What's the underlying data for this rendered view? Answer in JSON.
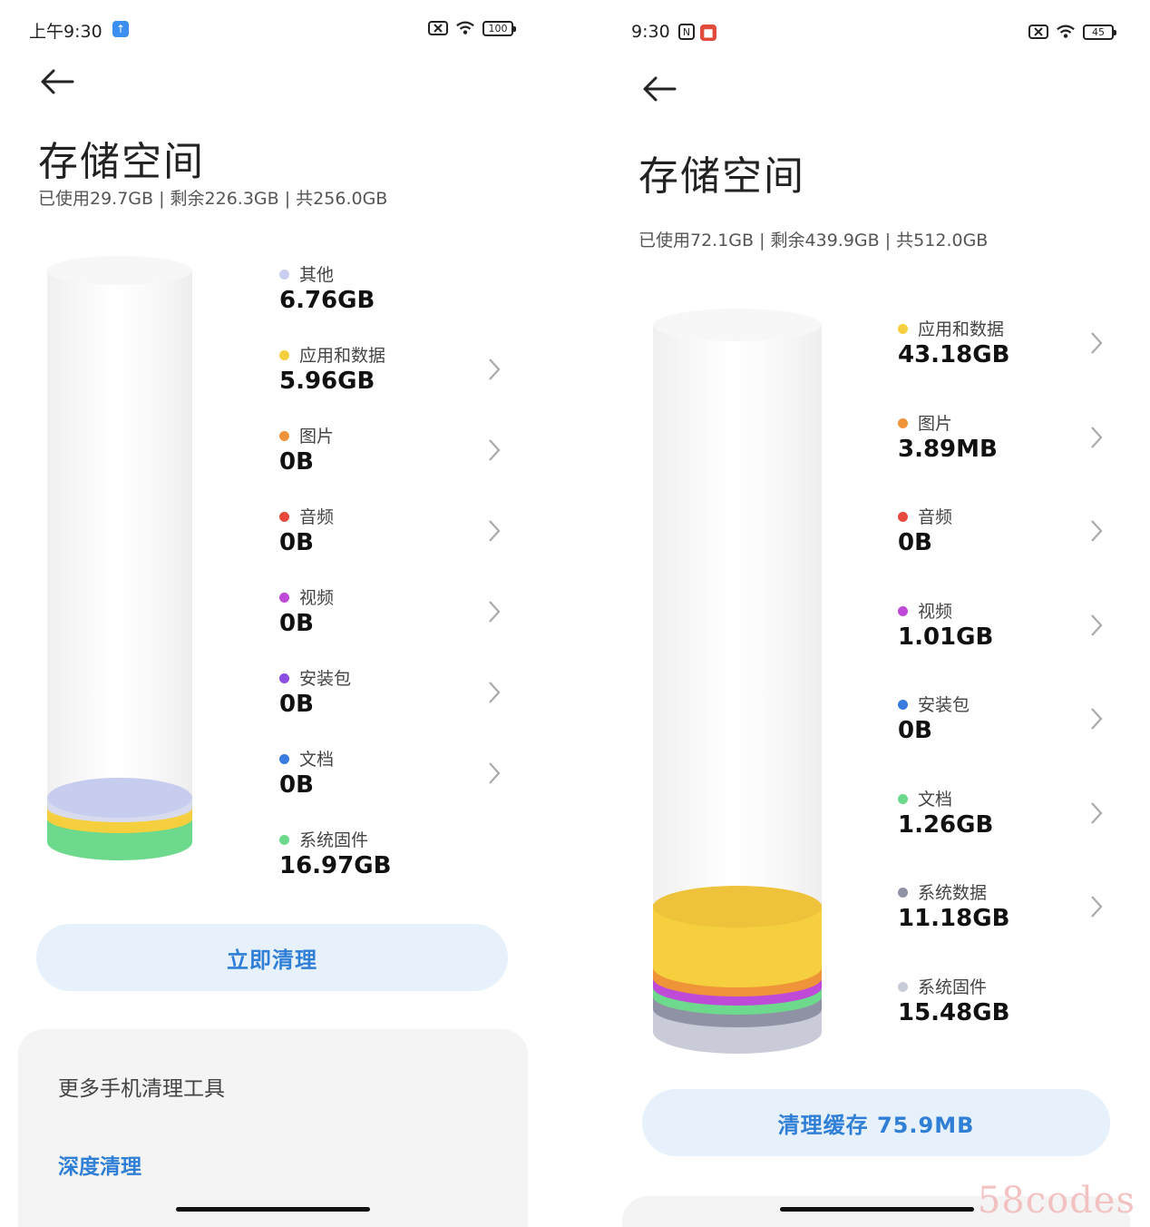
{
  "left": {
    "status": {
      "time": "上午9:30",
      "battery": "100"
    },
    "title": "存储空间",
    "summary": "已使用29.7GB | 剩余226.3GB | 共256.0GB",
    "items": [
      {
        "label": "其他",
        "value": "6.76GB",
        "color": "#c9cdf0",
        "chevron": false
      },
      {
        "label": "应用和数据",
        "value": "5.96GB",
        "color": "#f5cf3d",
        "chevron": true
      },
      {
        "label": "图片",
        "value": "0B",
        "color": "#f0943a",
        "chevron": true
      },
      {
        "label": "音频",
        "value": "0B",
        "color": "#e8493d",
        "chevron": true
      },
      {
        "label": "视频",
        "value": "0B",
        "color": "#c04ad8",
        "chevron": true
      },
      {
        "label": "安装包",
        "value": "0B",
        "color": "#8a4fe0",
        "chevron": true
      },
      {
        "label": "文档",
        "value": "0B",
        "color": "#3a7be0",
        "chevron": true
      },
      {
        "label": "系统固件",
        "value": "16.97GB",
        "color": "#6dd98c",
        "chevron": false
      }
    ],
    "action_button": "立即清理",
    "card": {
      "title": "更多手机清理工具",
      "link": "深度清理"
    }
  },
  "right": {
    "status": {
      "time": "9:30",
      "battery": "45"
    },
    "title": "存储空间",
    "summary": "已使用72.1GB | 剩余439.9GB | 共512.0GB",
    "items": [
      {
        "label": "应用和数据",
        "value": "43.18GB",
        "color": "#f5cf3d",
        "chevron": true
      },
      {
        "label": "图片",
        "value": "3.89MB",
        "color": "#f0943a",
        "chevron": true
      },
      {
        "label": "音频",
        "value": "0B",
        "color": "#e8493d",
        "chevron": true
      },
      {
        "label": "视频",
        "value": "1.01GB",
        "color": "#c04ad8",
        "chevron": true
      },
      {
        "label": "安装包",
        "value": "0B",
        "color": "#3a7be0",
        "chevron": true
      },
      {
        "label": "文档",
        "value": "1.26GB",
        "color": "#6dd98c",
        "chevron": true
      },
      {
        "label": "系统数据",
        "value": "11.18GB",
        "color": "#8f92a4",
        "chevron": true
      },
      {
        "label": "系统固件",
        "value": "15.48GB",
        "color": "#c9cbd8",
        "chevron": false
      }
    ],
    "action_button": "清理缓存 75.9MB"
  },
  "watermark": "58codes"
}
